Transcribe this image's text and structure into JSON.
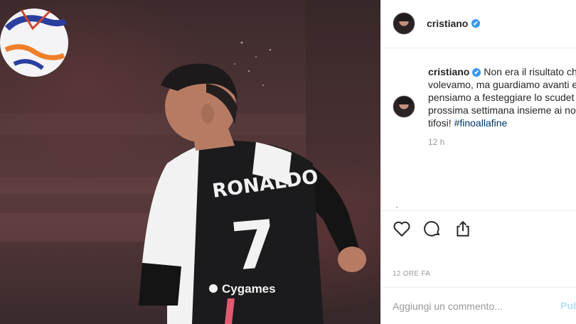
{
  "post": {
    "header": {
      "username": "cristiano",
      "verified_glyph": "✔"
    },
    "photo": {
      "jersey_name": "RONALDO",
      "jersey_number": "7",
      "sponsor": "Cygames",
      "colors": {
        "jersey_black": "#1b1b1d",
        "jersey_white": "#f2f2f2",
        "sleeve_black": "#141414",
        "ball_blue": "#2b3f9e",
        "ball_orange": "#ef7f2a"
      }
    },
    "caption": {
      "username": "cristiano",
      "verified_glyph": "✔",
      "lines": [
        "Non era il risultato ch",
        "volevamo, ma guardiamo avanti e",
        "pensiamo a festeggiare lo scudet",
        "prossima settimana insieme ai no"
      ],
      "last_line_text": "tifosi! ",
      "hashtag": "#finoallafine",
      "relative_time": "12 h"
    },
    "actions": {
      "like_icon": "heart-icon",
      "comment_icon": "comment-icon",
      "share_icon": "share-icon"
    },
    "date_label": "12 ORE FA",
    "comment": {
      "placeholder": "Aggiungi un commento...",
      "post_label": "Pub"
    },
    "colors": {
      "verified_blue": "#3897f0",
      "hashtag": "#003569",
      "muted": "#999999",
      "border": "#efefef"
    }
  }
}
